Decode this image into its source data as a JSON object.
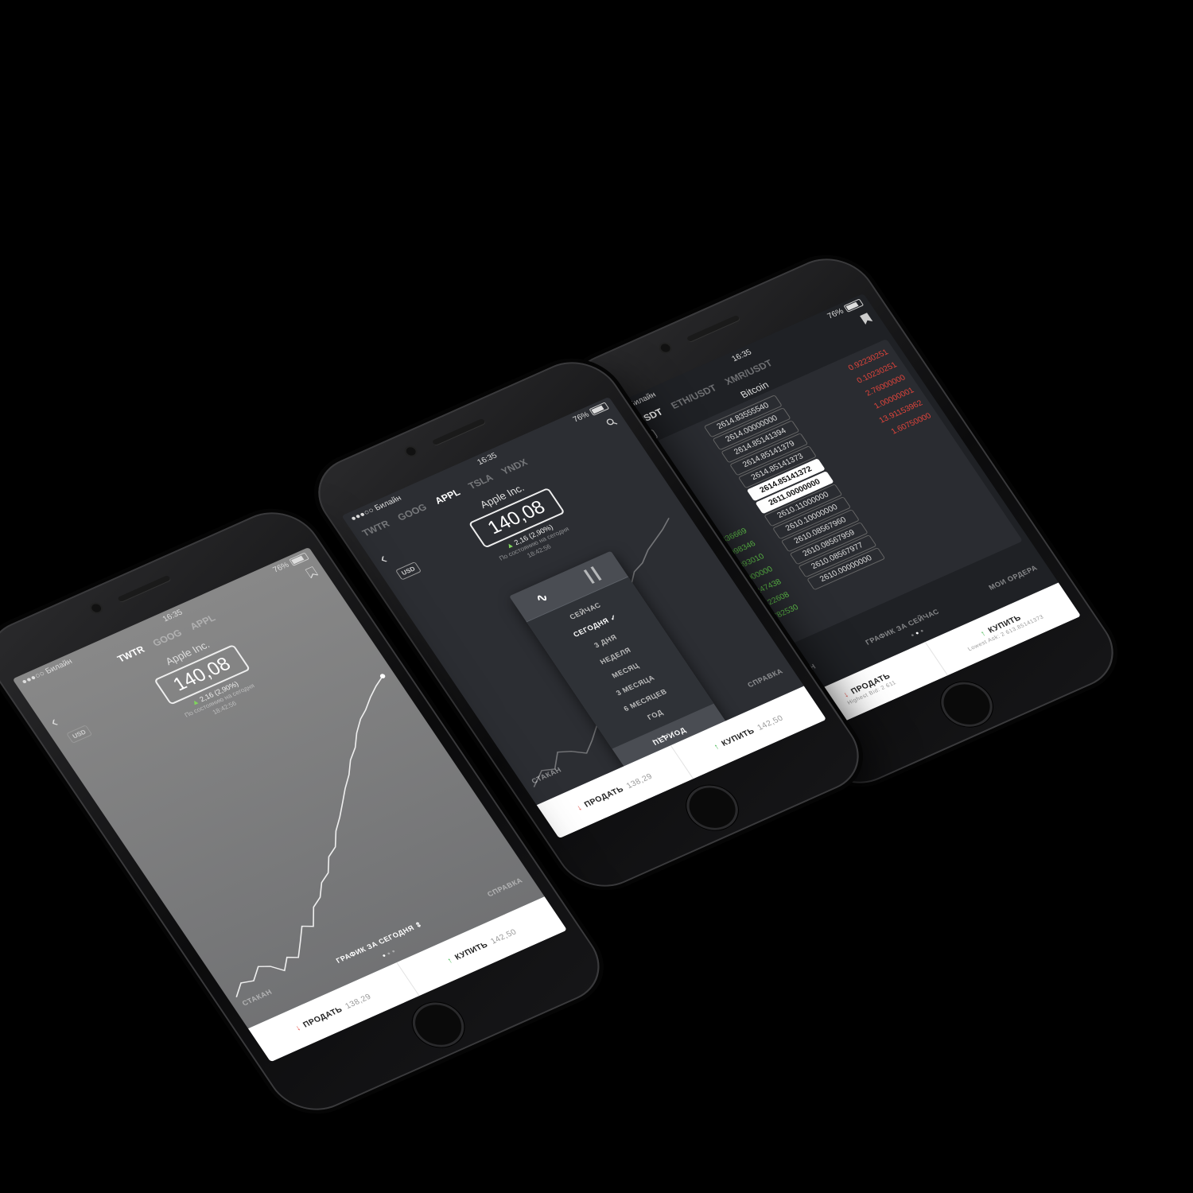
{
  "colors": {
    "background": "#000000",
    "accent_up": "#5fc24a",
    "accent_down": "#e0443b",
    "screen1": "#7b7b7d",
    "screen2": "#2c2e33",
    "screen3": "#1f2125"
  },
  "common": {
    "carrier": "●●●○○ Билайн",
    "time": "16:35",
    "battery": "76%",
    "company": "Apple Inc.",
    "currency": "USD",
    "price": "140,08",
    "change": "2,16 (2,90%)",
    "as_of_label": "По состоянию на сегодня",
    "as_of_time": "18:42:56",
    "nav_stakan": "СТАКАН",
    "nav_chart": "ГРАФИК ЗА СЕГОДНЯ",
    "nav_help": "СПРАВКА",
    "sell_label": "ПРОДАТЬ",
    "sell_price": "138,29",
    "buy_label": "КУПИТЬ",
    "buy_price": "142,50"
  },
  "phone1": {
    "tabs": [
      "TWTR",
      "GOOG",
      "APPL"
    ]
  },
  "phone2": {
    "tabs": [
      "TWTR",
      "GOOG",
      "APPL",
      "TSLA",
      "YNDX"
    ],
    "period_menu": {
      "options": [
        "СЕЙЧАС",
        "СЕГОДНЯ",
        "3 ДНЯ",
        "НЕДЕЛЯ",
        "МЕСЯЦ",
        "3 МЕСЯЦА",
        "6 МЕСЯЦЕВ",
        "ГОД"
      ],
      "selected": "СЕГОДНЯ",
      "footer": "ПЕРИОД"
    }
  },
  "phone3": {
    "tabs": [
      "BTC/USDT",
      "ETH/USDT",
      "XMR/USDT"
    ],
    "title": "Bitcoin",
    "currency": "USDT",
    "asks": [
      {
        "price": "2614.83555540",
        "vol": "0.92230251"
      },
      {
        "price": "2614.00000000",
        "vol": "0.10230251"
      },
      {
        "price": "2614.85141394",
        "vol": "2.76000000"
      },
      {
        "price": "2614.85141379",
        "vol": "1.00000001"
      },
      {
        "price": "2614.85141373",
        "vol": "13.91153962"
      },
      {
        "price": "2614.85141372",
        "vol": "1.60750000"
      }
    ],
    "bids": [
      {
        "price": "2611.00000000",
        "vol": ""
      },
      {
        "price": "2610.11000000",
        "vol": "0.75836669"
      },
      {
        "price": "2610.10000000",
        "vol": "0.14098346"
      },
      {
        "price": "2610.08567960",
        "vol": "0.08893010"
      },
      {
        "price": "2610.08567959",
        "vol": "1.50000000"
      },
      {
        "price": "2610.08567977",
        "vol": "1.08247438"
      },
      {
        "price": "2610.00000000",
        "vol": "0.11522608"
      },
      {
        "price": "",
        "vol": "0.18782530"
      }
    ],
    "nav_stakan": "СТАКАН",
    "nav_chart": "ГРАФИК ЗА СЕЙЧАС",
    "nav_orders": "МОИ ОРДЕРА",
    "sell_label": "ПРОДАТЬ",
    "sell_sub": "Highest Bid: 2 611",
    "buy_label": "КУПИТЬ",
    "buy_sub": "Lowest Ask: 2 613.85141373"
  }
}
